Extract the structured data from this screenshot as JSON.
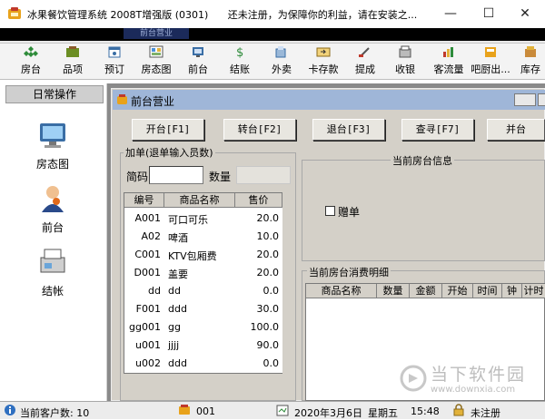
{
  "window": {
    "title": "冰果餐饮管理系统   2008T增强版 (0301)",
    "notice": "还未注册，为保障你的利益，请在安装之...",
    "minimize": "—",
    "maximize": "☐",
    "close": "✕"
  },
  "menubar_tag": "前台营业",
  "toolbar": [
    {
      "label": "房台",
      "icon": "room-icon"
    },
    {
      "label": "品项",
      "icon": "items-icon"
    },
    {
      "label": "预订",
      "icon": "booking-icon"
    },
    {
      "label": "房态图",
      "icon": "room-status-icon"
    },
    {
      "label": "前台",
      "icon": "front-desk-icon"
    },
    {
      "label": "结账",
      "icon": "checkout-icon"
    },
    {
      "label": "外卖",
      "icon": "takeout-icon"
    },
    {
      "label": "卡存款",
      "icon": "card-deposit-icon"
    },
    {
      "label": "提成",
      "icon": "commission-icon"
    },
    {
      "label": "收银",
      "icon": "cashier-icon"
    },
    {
      "label": "客流量",
      "icon": "traffic-icon"
    },
    {
      "label": "吧厨出...",
      "icon": "kitchen-icon"
    },
    {
      "label": "库存",
      "icon": "stock-icon"
    }
  ],
  "sidebar": {
    "header": "日常操作",
    "items": [
      {
        "label": "房态图",
        "icon": "room-status-icon"
      },
      {
        "label": "前台",
        "icon": "front-desk-icon"
      },
      {
        "label": "结帐",
        "icon": "checkout-icon"
      }
    ]
  },
  "child_window": {
    "title": "前台营业",
    "buttons": [
      "开台[F1]",
      "转台[F2]",
      "退台[F3]",
      "查寻[F7]",
      "并台"
    ],
    "order_group": "加单(退单输入员数)",
    "code_label": "简码",
    "code_value": "",
    "qty_label": "数量",
    "qty_value": "",
    "current_room_group": "当前房台信息",
    "gift_label": "赠单",
    "consumption_group": "当前房台消费明细"
  },
  "item_table": {
    "columns": [
      "编号",
      "商品名称",
      "售价"
    ],
    "rows": [
      {
        "code": "A001",
        "name": "可口可乐",
        "price": "20.0"
      },
      {
        "code": "A02",
        "name": "啤酒",
        "price": "10.0"
      },
      {
        "code": "C001",
        "name": "KTV包厢费",
        "price": "20.0"
      },
      {
        "code": "D001",
        "name": "盖要",
        "price": "20.0"
      },
      {
        "code": "dd",
        "name": "dd",
        "price": "0.0"
      },
      {
        "code": "F001",
        "name": "ddd",
        "price": "30.0"
      },
      {
        "code": "gg001",
        "name": "gg",
        "price": "100.0"
      },
      {
        "code": "u001",
        "name": "jjjj",
        "price": "90.0"
      },
      {
        "code": "u002",
        "name": "ddd",
        "price": "0.0"
      }
    ]
  },
  "detail_table": {
    "columns": [
      "商品名称",
      "数量",
      "金额",
      "开始",
      "时间",
      "钟",
      "计时"
    ]
  },
  "statusbar": {
    "customers": "当前客户数: 10",
    "operator": "001",
    "date": "2020年3月6日",
    "weekday": "星期五",
    "time": "15:48",
    "registration": "未注册"
  },
  "watermark": {
    "name": "当下软件园",
    "url": "www.downxia.com"
  },
  "colors": {
    "child_title": "#9fb6d8",
    "face": "#d4d0c8",
    "mdi_background": "#8a8a8a"
  }
}
